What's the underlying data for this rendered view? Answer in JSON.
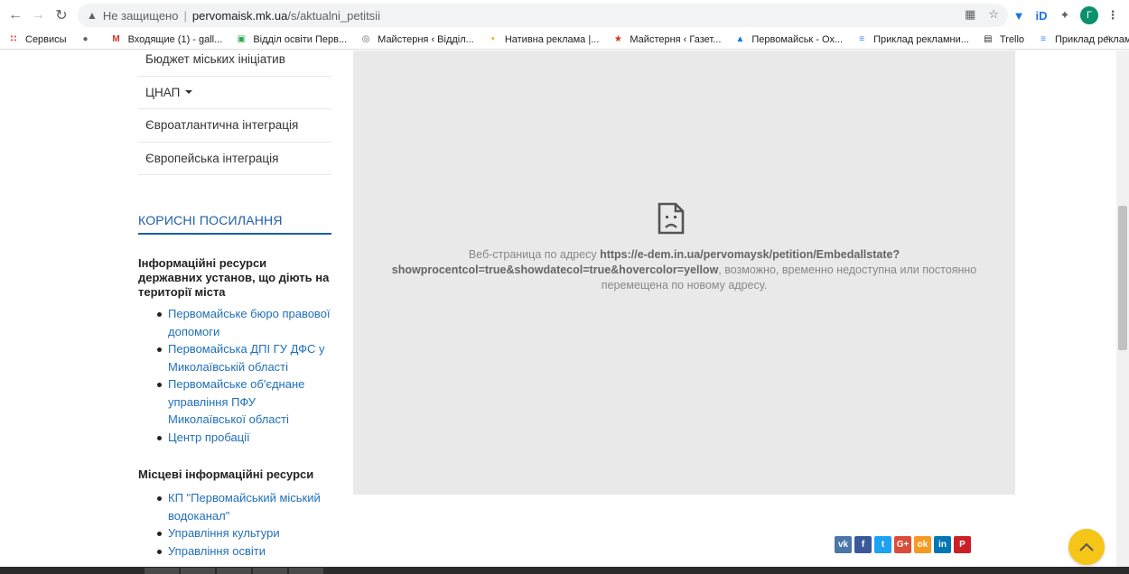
{
  "browser": {
    "insecure_label": "Не защищено",
    "url_host": "pervomaisk.mk.ua",
    "url_path": "/s/aktualni_petitsii",
    "avatar_letter": "Г"
  },
  "bookmarks": [
    {
      "label": "Сервисы",
      "icon": "apps-grid-icon",
      "color": "#e8453c"
    },
    {
      "label": "",
      "icon": "globe-icon",
      "color": "#5f6368"
    },
    {
      "label": "Входящие (1) - gall...",
      "icon": "gmail-icon",
      "color": "#d93025"
    },
    {
      "label": "Відділ освіти Перв...",
      "icon": "edu-icon",
      "color": "#34a853"
    },
    {
      "label": "Майстерня ‹ Відділ...",
      "icon": "wordpress-icon",
      "color": "#5f6368"
    },
    {
      "label": "Нативна реклама |...",
      "icon": "bulb-icon",
      "color": "#f9ab00"
    },
    {
      "label": "Майстерня ‹ Газет...",
      "icon": "star-logo-icon",
      "color": "#d93025"
    },
    {
      "label": "Первомайськ - Ох...",
      "icon": "drive-icon",
      "color": "#1a73e8"
    },
    {
      "label": "Приклад рекламни...",
      "icon": "docs-icon",
      "color": "#4285f4"
    },
    {
      "label": "Trello",
      "icon": "trello-icon",
      "color": "#333333"
    },
    {
      "label": "Приклад рекламни...",
      "icon": "docs-icon",
      "color": "#4285f4"
    }
  ],
  "bookmarks_more": "»",
  "menu": {
    "items": [
      {
        "label": "Бюджет міських ініціатив"
      },
      {
        "label": "ЦНАП"
      },
      {
        "label": "Євроатлантична інтеграція"
      },
      {
        "label": "Європейська інтеграція"
      }
    ]
  },
  "useful": {
    "title": "КОРИСНІ ПОСИЛАННЯ",
    "section1_title": "Інформаційні ресурси державних установ, що діють на території міста",
    "section1_links": [
      "Первомайське бюро правової допомоги",
      "Первомайська ДПІ ГУ ДФС у Миколаївській області",
      "Первомайське об'єднане управління ПФУ Миколаївської області",
      "Центр пробації"
    ],
    "section2_title": "Місцеві інформаційні ресурси",
    "section2_links": [
      "КП \"Первомайський міський водоканал\"",
      "Управління культури",
      "Управління освіти"
    ]
  },
  "error": {
    "prefix": "Веб-страница по адресу ",
    "url": "https://e-dem.in.ua/pervomaysk/petition/Embedallstate?showprocentcol=true&showdatecol=true&hovercolor=yellow",
    "suffix": ", возможно, временно недоступна или постоянно перемещена по новому адресу."
  },
  "social": [
    {
      "label": "vk",
      "icon": "vk-icon",
      "color": "#4a76a8"
    },
    {
      "label": "f",
      "icon": "facebook-icon",
      "color": "#3b5998"
    },
    {
      "label": "t",
      "icon": "twitter-icon",
      "color": "#1da1f2"
    },
    {
      "label": "G+",
      "icon": "googleplus-icon",
      "color": "#dd4b39"
    },
    {
      "label": "ok",
      "icon": "odnoklassniki-icon",
      "color": "#f59a23"
    },
    {
      "label": "in",
      "icon": "linkedin-icon",
      "color": "#0077b5"
    },
    {
      "label": "P",
      "icon": "pinterest-icon",
      "color": "#cb2027"
    }
  ]
}
